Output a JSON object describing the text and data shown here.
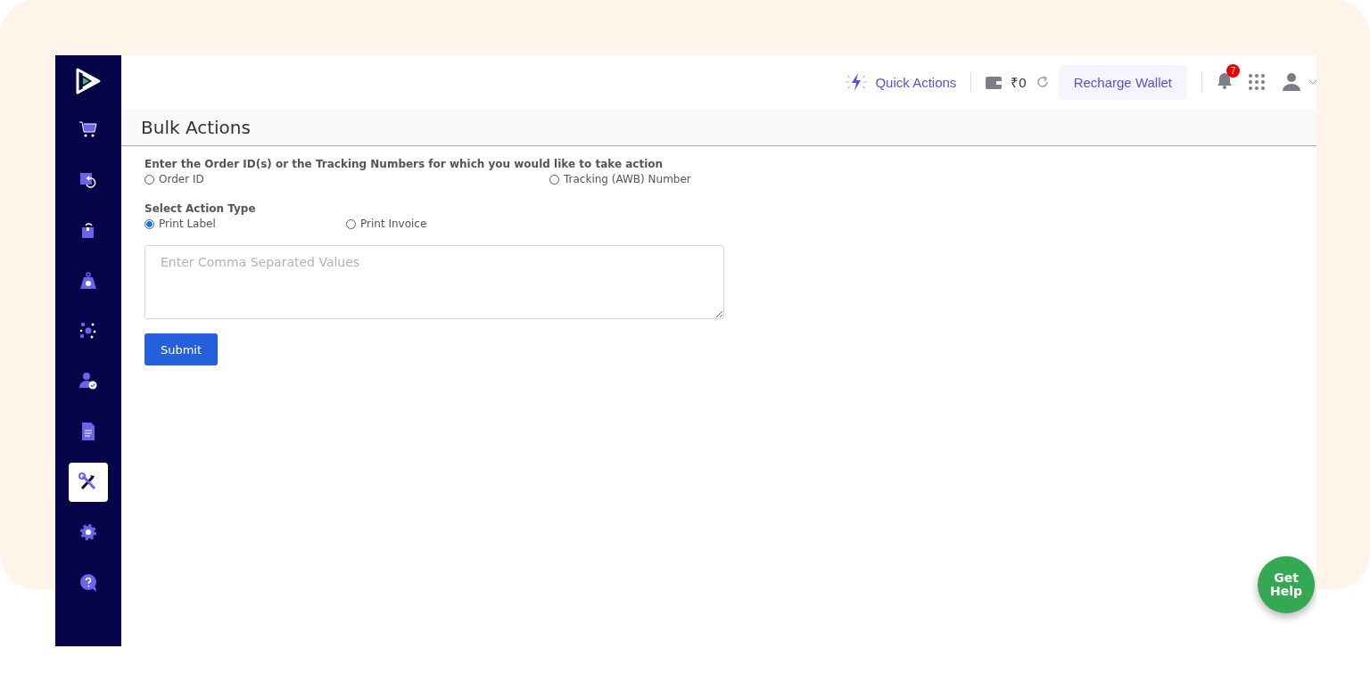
{
  "sidebar": {
    "items": [
      {
        "kind": "cart",
        "selected": false
      },
      {
        "kind": "return",
        "selected": false
      },
      {
        "kind": "package",
        "selected": false
      },
      {
        "kind": "weight",
        "selected": false
      },
      {
        "kind": "network",
        "selected": false
      },
      {
        "kind": "user",
        "selected": false
      },
      {
        "kind": "document",
        "selected": false
      },
      {
        "kind": "tools",
        "selected": true
      },
      {
        "kind": "settings",
        "selected": false
      },
      {
        "kind": "help",
        "selected": false
      }
    ]
  },
  "top_bar": {
    "quick_actions": "Quick Actions",
    "wallet_balance": "₹0",
    "recharge_button": "Recharge Wallet",
    "notification_count": "7"
  },
  "page": {
    "title": "Bulk Actions",
    "id_prompt": "Enter the Order ID(s) or the Tracking Numbers for which you would like to take action",
    "id_options": [
      {
        "label": "Order ID",
        "selected": false
      },
      {
        "label": "Tracking (AWB) Number",
        "selected": false
      }
    ],
    "action_prompt": "Select Action Type",
    "action_options": [
      {
        "label": "Print Label",
        "selected": true
      },
      {
        "label": "Print Invoice",
        "selected": false
      }
    ],
    "values_field": {
      "placeholder": "Enter Comma Separated Values"
    },
    "submit_button": "Submit"
  },
  "help_button": "Get Help"
}
